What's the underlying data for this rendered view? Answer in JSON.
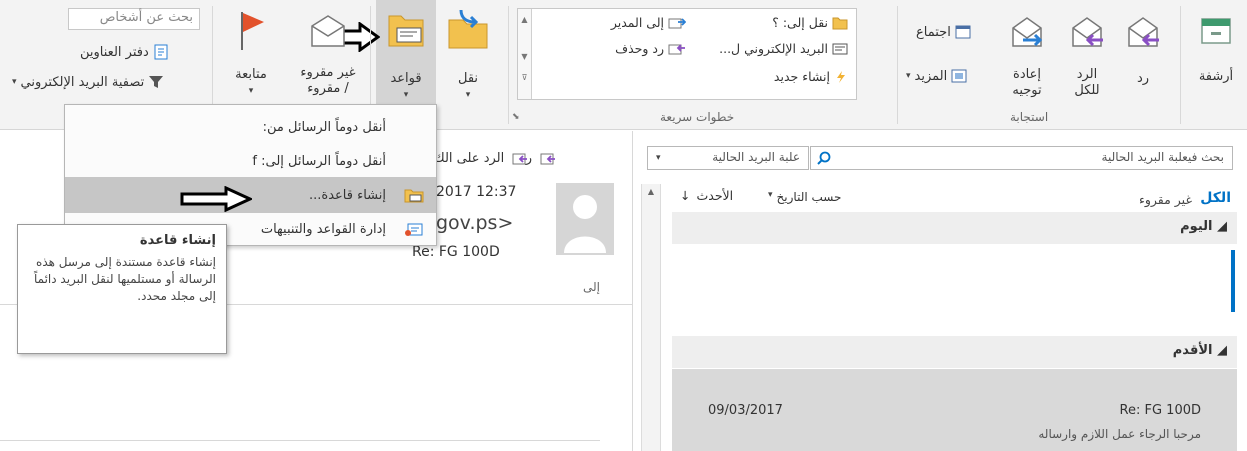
{
  "ribbon": {
    "archive": "أرشفة",
    "respond": {
      "reply": "رد",
      "reply_all": "الرد للكل",
      "forward": "إعادة توجيه",
      "meeting": "اجتماع",
      "more": "المزيد",
      "group_label": "استجابة"
    },
    "quick_steps": {
      "items": [
        "نقل إلى: ؟",
        "إلى المدير",
        "البريد الإلكتروني ل...",
        "رد وحذف",
        "إنشاء جديد"
      ],
      "group_label": "خطوات سريعة"
    },
    "move": {
      "move": "نقل",
      "rules": "قواعد",
      "group_label": "نق"
    },
    "tags": {
      "unread_read": "غير مقروء / مقروء",
      "follow_up": "متابعة"
    },
    "find": {
      "search_people_placeholder": "بحث عن أشخاص",
      "address_book": "دفتر العناوين",
      "filter_email": "تصفية البريد الإلكتروني"
    }
  },
  "rules_menu": {
    "items": [
      "أنقل دوماً الرسائل من:",
      "أنقل دوماً الرسائل إلى: f",
      "إنشاء قاعدة...",
      "إدارة القواعد والتنبيهات"
    ]
  },
  "tooltip": {
    "title": "إنشاء قاعدة",
    "body": "إنشاء قاعدة مستندة إلى مرسل هذه الرسالة أو مستلميها لنقل البريد دائماً إلى مجلد محدد."
  },
  "reading_pane": {
    "reply": "رد",
    "reply_all": "الرد على الك",
    "date": "2017 12:37",
    "sender": "gov.ps>",
    "subject": "Re: FG 100D",
    "to_label": "إلى"
  },
  "message_list": {
    "search_placeholder": "بحث فيعلبة البريد الحالية",
    "scope": "علبة البريد الحالية",
    "filter_all": "الكل",
    "filter_unread": "غير مقروء",
    "sort_by": "حسب التاريخ",
    "order": "الأحدث",
    "section_today": "اليوم",
    "section_older": "الأقدم",
    "messages": [
      {
        "subject": "Re: FG 100D",
        "date": "09/03/2017",
        "preview": "مرحبا  الرجاء عمل اللازم وارساله"
      }
    ]
  },
  "colors": {
    "accent": "#0072c6",
    "flag": "#e2522c",
    "reply_arrow": "#8a4fc4",
    "forward_arrow": "#2a7fd4",
    "highlight": "#c6c6c6"
  }
}
